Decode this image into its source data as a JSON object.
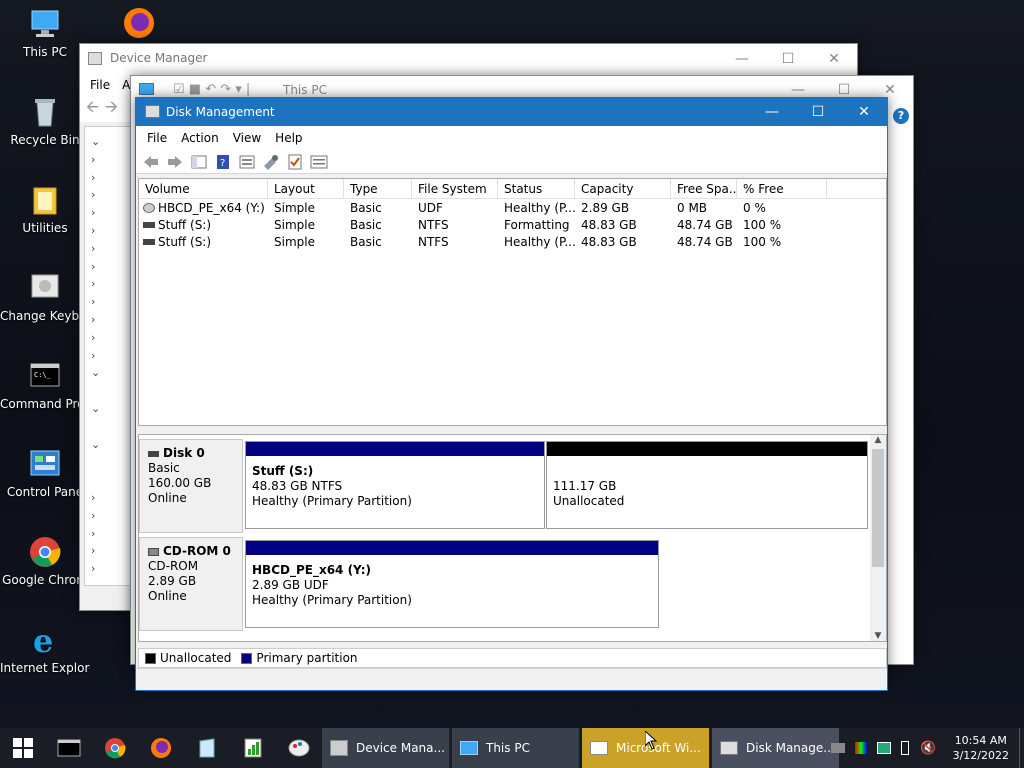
{
  "desktop_icons": [
    {
      "label": "This PC",
      "icon": "computer-icon"
    },
    {
      "label": "Recycle Bin",
      "icon": "recycle-bin-icon"
    },
    {
      "label": "Utilities",
      "icon": "folder-icon"
    },
    {
      "label": "Change Keyboard Layo",
      "icon": "keyboard-icon"
    },
    {
      "label": "Command Prompt",
      "icon": "console-icon"
    },
    {
      "label": "Control Pane",
      "icon": "control-panel-icon"
    },
    {
      "label": "Google Chrom",
      "icon": "chrome-icon"
    },
    {
      "label": "Internet Explorer",
      "icon": "ie-icon"
    },
    {
      "label": "",
      "icon": "firefox-icon"
    }
  ],
  "device_manager": {
    "title": "Device Manager",
    "menu": [
      "File",
      "A"
    ]
  },
  "this_pc": {
    "title": "This PC"
  },
  "disk_management": {
    "title": "Disk Management",
    "menu": [
      "File",
      "Action",
      "View",
      "Help"
    ],
    "columns": [
      "Volume",
      "Layout",
      "Type",
      "File System",
      "Status",
      "Capacity",
      "Free Spa...",
      "% Free"
    ],
    "rows": [
      [
        "HBCD_PE_x64 (Y:)",
        "Simple",
        "Basic",
        "UDF",
        "Healthy (P...",
        "2.89 GB",
        "0 MB",
        "0 %"
      ],
      [
        "Stuff (S:)",
        "Simple",
        "Basic",
        "NTFS",
        "Formatting",
        "48.83 GB",
        "48.74 GB",
        "100 %"
      ],
      [
        "Stuff (S:)",
        "Simple",
        "Basic",
        "NTFS",
        "Healthy (P...",
        "48.83 GB",
        "48.74 GB",
        "100 %"
      ]
    ],
    "disks": [
      {
        "name": "Disk 0",
        "type": "Basic",
        "size": "160.00 GB",
        "state": "Online",
        "partitions": [
          {
            "name": "Stuff  (S:)",
            "detail": "48.83 GB NTFS",
            "status": "Healthy (Primary Partition)"
          },
          {
            "name": "",
            "detail": "111.17 GB",
            "status": "Unallocated"
          }
        ]
      },
      {
        "name": "CD-ROM 0",
        "type": "CD-ROM",
        "size": "2.89 GB",
        "state": "Online",
        "partitions": [
          {
            "name": "HBCD_PE_x64  (Y:)",
            "detail": "2.89 GB UDF",
            "status": "Healthy (Primary Partition)"
          }
        ]
      }
    ],
    "legend": [
      {
        "label": "Unallocated",
        "color": "#000000"
      },
      {
        "label": "Primary partition",
        "color": "#000080"
      }
    ]
  },
  "taskbar": {
    "apps": [
      {
        "label": "Device Mana...",
        "active": false
      },
      {
        "label": "This PC",
        "active": false
      },
      {
        "label": "Microsoft Wi...",
        "active": true
      },
      {
        "label": "Disk Manage...",
        "active": false
      }
    ],
    "time": "10:54 AM",
    "date": "3/12/2022"
  },
  "colors": {
    "accent": "#1e73be",
    "primary_partition": "#000080",
    "unallocated": "#000000",
    "highlight_task": "#c9a227"
  }
}
